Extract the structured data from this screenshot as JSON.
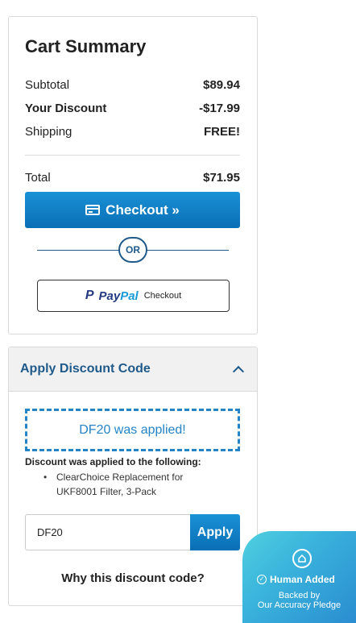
{
  "cart_summary": {
    "title": "Cart Summary",
    "subtotal_label": "Subtotal",
    "subtotal_value": "$89.94",
    "discount_label": "Your Discount",
    "discount_value": "-$17.99",
    "shipping_label": "Shipping",
    "shipping_value": "FREE!",
    "total_label": "Total",
    "total_value": "$71.95",
    "checkout_label": "Checkout »",
    "or_label": "OR",
    "paypal": {
      "mark": "P",
      "pay": "Pay",
      "pal": "Pal",
      "checkout": "Checkout"
    }
  },
  "discount_panel": {
    "title": "Apply Discount Code",
    "applied_message": "DF20 was applied!",
    "applied_note": "Discount was applied to the following:",
    "applied_items": [
      "ClearChoice Replacement for UKF8001 Filter, 3-Pack"
    ],
    "code_value": "DF20",
    "apply_label": "Apply",
    "why_link": "Why this discount code?"
  },
  "badge": {
    "human_added": "Human Added",
    "backed_by": "Backed by",
    "pledge": "Our Accuracy Pledge"
  },
  "colors": {
    "primary_blue": "#0a6fb5",
    "heading_blue": "#1f5a8a",
    "applied_blue": "#2484c6",
    "badge_teal": "#4fd0e0"
  }
}
